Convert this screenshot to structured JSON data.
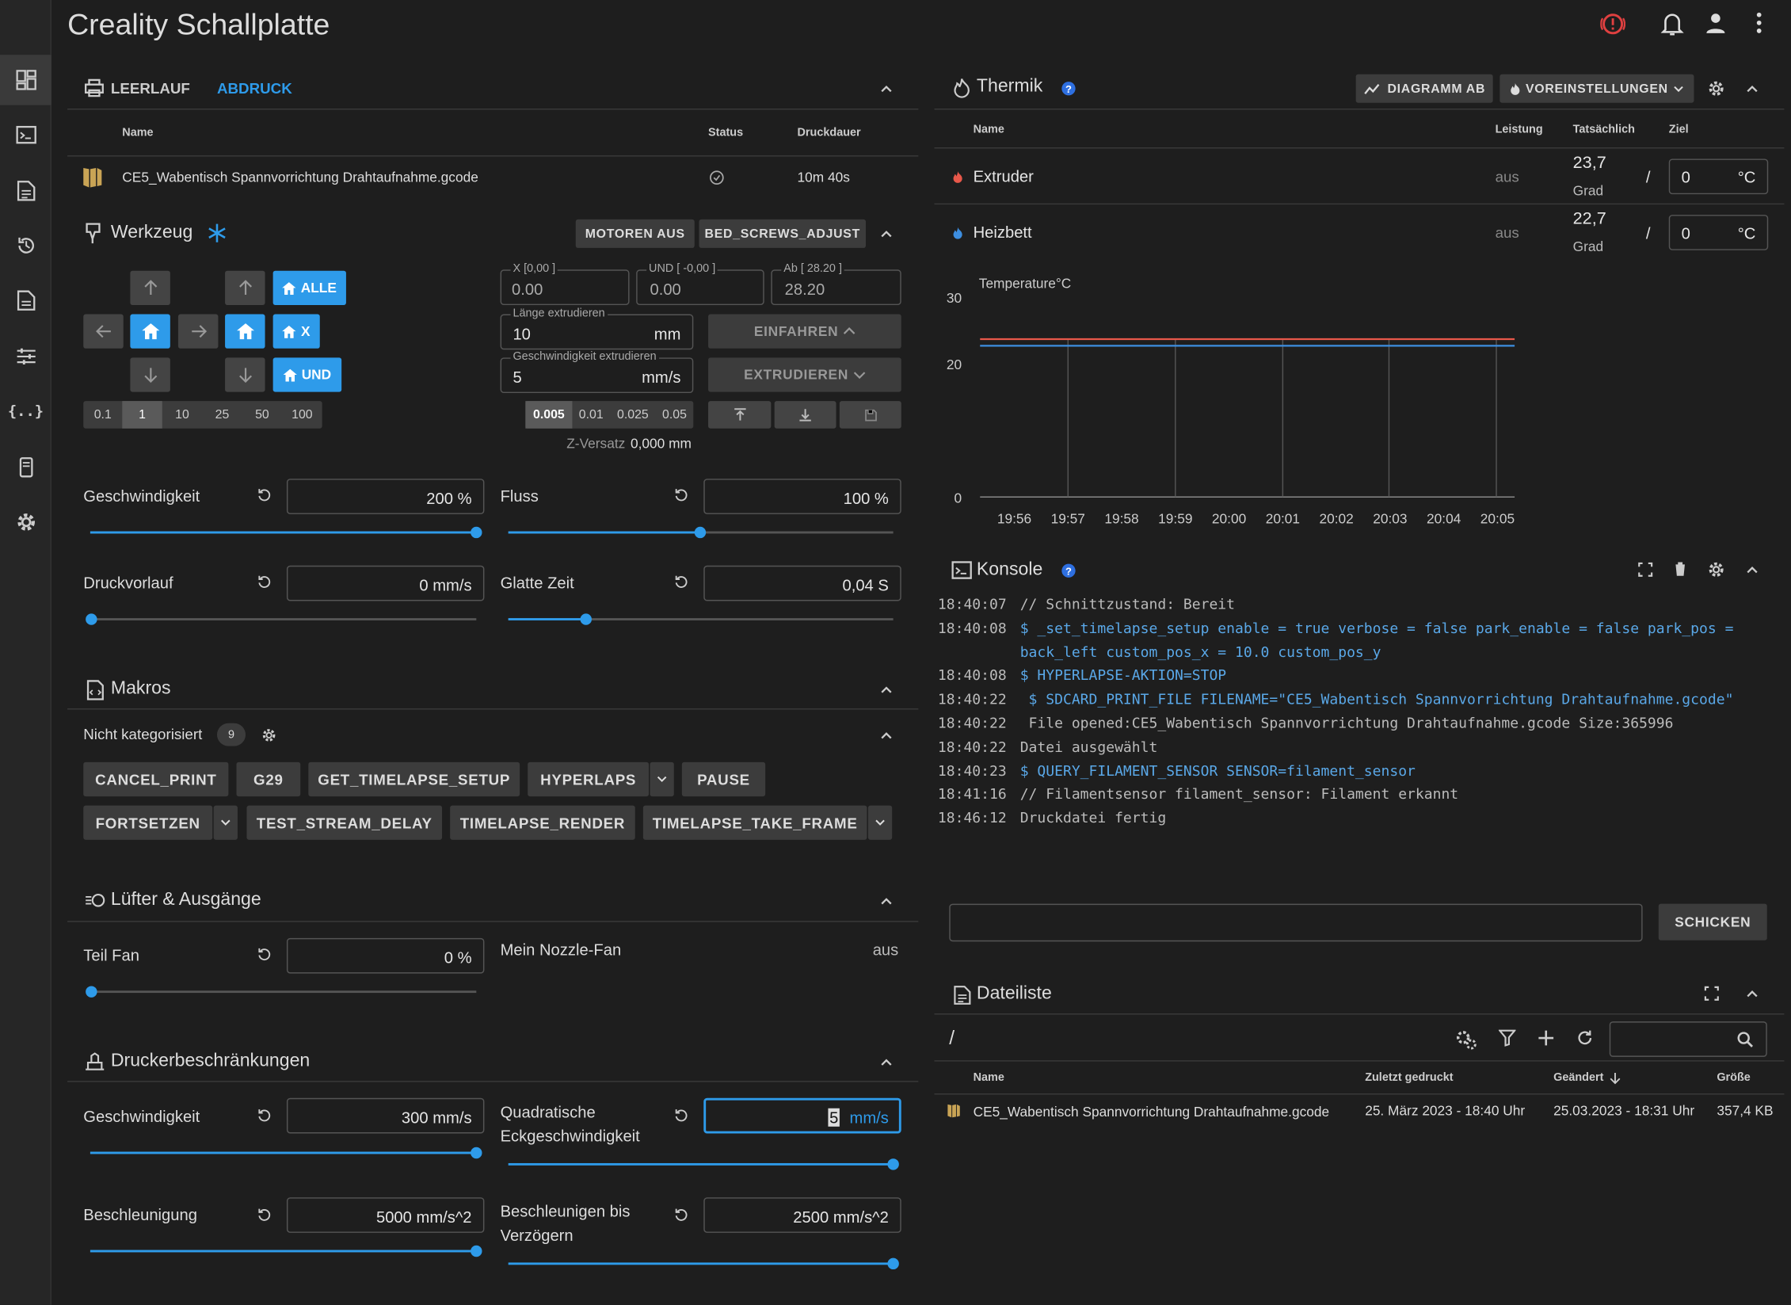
{
  "app": {
    "title": "Creality Schallplatte"
  },
  "rail": [
    {
      "icon": "dashboard-icon"
    },
    {
      "icon": "console-icon"
    },
    {
      "icon": "files-icon"
    },
    {
      "icon": "history-icon"
    },
    {
      "icon": "gcode-file-icon"
    },
    {
      "icon": "tune-icon"
    },
    {
      "icon": "config-icon"
    },
    {
      "icon": "device-icon"
    },
    {
      "icon": "settings-icon"
    }
  ],
  "status": {
    "tab_idle": "LEERLAUF",
    "tab_print": "ABDRUCK",
    "col_name": "Name",
    "col_status": "Status",
    "col_duration": "Druckdauer",
    "file": "CE5_Wabentisch Spannvorrichtung Drahtaufnahme.gcode",
    "duration": "10m 40s"
  },
  "tool": {
    "title": "Werkzeug",
    "motors_off": "MOTOREN AUS",
    "bed_screws": "BED_SCREWS_ADJUST",
    "home_all": "ALLE",
    "home_x": "X",
    "home_y": "UND",
    "steps": [
      "0.1",
      "1",
      "10",
      "25",
      "50",
      "100"
    ],
    "x_label": "X [0,00 ]",
    "x_val": "0.00",
    "y_label": "UND [ -0,00 ]",
    "y_val": "0.00",
    "z_label": "Ab [ 28.20 ]",
    "z_val": "28.20",
    "len_label": "Länge extrudieren",
    "len_val": "10",
    "len_unit": "mm",
    "spd_label": "Geschwindigkeit extrudieren",
    "spd_val": "5",
    "spd_unit": "mm/s",
    "retract": "EINFAHREN",
    "extrude": "EXTRUDIEREN",
    "zsteps": [
      "0.005",
      "0.01",
      "0.025",
      "0.05"
    ],
    "zoffset_label": "Z-Versatz",
    "zoffset_val": "0,000 mm",
    "speed_label": "Geschwindigkeit",
    "speed_val": "200 %",
    "flow_label": "Fluss",
    "flow_val": "100 %",
    "pa_label": "Druckvorlauf",
    "pa_val": "0 mm/s",
    "smooth_label": "Glatte Zeit",
    "smooth_val": "0,04 S",
    "speed_level": 0.99,
    "flow_level": 0.49,
    "pa_level": 0.0,
    "smooth_level": 0.2
  },
  "macros": {
    "title": "Makros",
    "category": "Nicht kategorisiert",
    "count": "9",
    "items": [
      "CANCEL_PRINT",
      "G29",
      "GET_TIMELAPSE_SETUP",
      "HYPERLAPS",
      "PAUSE",
      "FORTSETZEN",
      "TEST_STREAM_DELAY",
      "TIMELAPSE_RENDER",
      "TIMELAPSE_TAKE_FRAME"
    ]
  },
  "fans": {
    "title": "Lüfter & Ausgänge",
    "part_fan": "Teil Fan",
    "part_val": "0 %",
    "part_level": 0.0,
    "nozzle_fan": "Mein Nozzle-Fan",
    "nozzle_state": "aus"
  },
  "limits": {
    "title": "Druckerbeschränkungen",
    "vel_label": "Geschwindigkeit",
    "vel_val": "300 mm/s",
    "vel_level": 0.99,
    "scv_label1": "Quadratische",
    "scv_label2": "Eckgeschwindigkeit",
    "scv_val": "5",
    "scv_unit": "mm/s",
    "scv_level": 1.0,
    "acc_label": "Beschleunigung",
    "acc_val": "5000 mm/s^2",
    "acc_level": 0.99,
    "a2d_label1": "Beschleunigen bis",
    "a2d_label2": "Verzögern",
    "a2d_val": "2500 mm/s^2",
    "a2d_level": 1.0
  },
  "thermal": {
    "title": "Thermik",
    "chart_btn": "DIAGRAMM AB",
    "presets_btn": "VOREINSTELLUNGEN",
    "col_name": "Name",
    "col_power": "Leistung",
    "col_actual": "Tatsächlich",
    "col_target": "Ziel",
    "heaters": [
      {
        "name": "Extruder",
        "power": "aus",
        "actual": "23,7",
        "unit": "Grad",
        "target": "0",
        "tunit": "°C",
        "color": "#e8584a"
      },
      {
        "name": "Heizbett",
        "power": "aus",
        "actual": "22,7",
        "unit": "Grad",
        "target": "0",
        "tunit": "°C",
        "color": "#3d8ee0"
      }
    ]
  },
  "chart_data": {
    "type": "line",
    "ylabel": "Temperature°C",
    "ylim": [
      0,
      30
    ],
    "yticks": [
      "30",
      "20",
      "0"
    ],
    "categories": [
      "19:56",
      "19:57",
      "19:58",
      "19:59",
      "20:00",
      "20:01",
      "20:02",
      "20:03",
      "20:04",
      "20:05"
    ],
    "series": [
      {
        "values": [
          23.7,
          23.7,
          23.7,
          23.7,
          23.7,
          23.7,
          23.7,
          23.7,
          23.7,
          23.7,
          23.7
        ],
        "color": "#e8584a"
      },
      {
        "values": [
          22.7,
          22.7,
          22.7,
          22.7,
          22.7,
          22.7,
          22.7,
          22.7,
          22.7,
          22.7,
          22.7
        ],
        "color": "#3d8ee0"
      }
    ]
  },
  "console": {
    "title": "Konsole",
    "send": "SCHICKEN",
    "lines": [
      {
        "t": "18:40:07",
        "m": "// Schnittzustand: Bereit",
        "k": "msg"
      },
      {
        "t": "18:40:08",
        "m": "$ _set_timelapse_setup enable = true verbose = false park_enable = false park_pos =",
        "k": "cmd"
      },
      {
        "t": "",
        "m": "back_left custom_pos_x = 10.0 custom_pos_y",
        "k": "cmd"
      },
      {
        "t": "18:40:08",
        "m": "$ HYPERLAPSE-AKTION=STOP",
        "k": "cmd"
      },
      {
        "t": "18:40:22",
        "m": " $ SDCARD_PRINT_FILE FILENAME=\"CE5_Wabentisch Spannvorrichtung Drahtaufnahme.gcode\"",
        "k": "cmd"
      },
      {
        "t": "18:40:22",
        "m": " File opened:CE5_Wabentisch Spannvorrichtung Drahtaufnahme.gcode Size:365996",
        "k": "msg"
      },
      {
        "t": "18:40:22",
        "m": "Datei ausgewählt",
        "k": "msg"
      },
      {
        "t": "18:40:23",
        "m": "$ QUERY_FILAMENT_SENSOR SENSOR=filament_sensor",
        "k": "cmd"
      },
      {
        "t": "18:41:16",
        "m": "// Filamentsensor filament_sensor: Filament erkannt",
        "k": "msg"
      },
      {
        "t": "18:46:12",
        "m": "Druckdatei fertig",
        "k": "msg"
      }
    ]
  },
  "files": {
    "title": "Dateiliste",
    "path": "/",
    "col_name": "Name",
    "col_printed": "Zuletzt gedruckt",
    "col_changed": "Geändert",
    "col_size": "Größe",
    "rows": [
      {
        "name": "CE5_Wabentisch Spannvorrichtung Drahtaufnahme.gcode",
        "printed": "25. März 2023 - 18:40 Uhr",
        "changed": "25.03.2023 - 18:31 Uhr",
        "size": "357,4 KB"
      }
    ]
  }
}
